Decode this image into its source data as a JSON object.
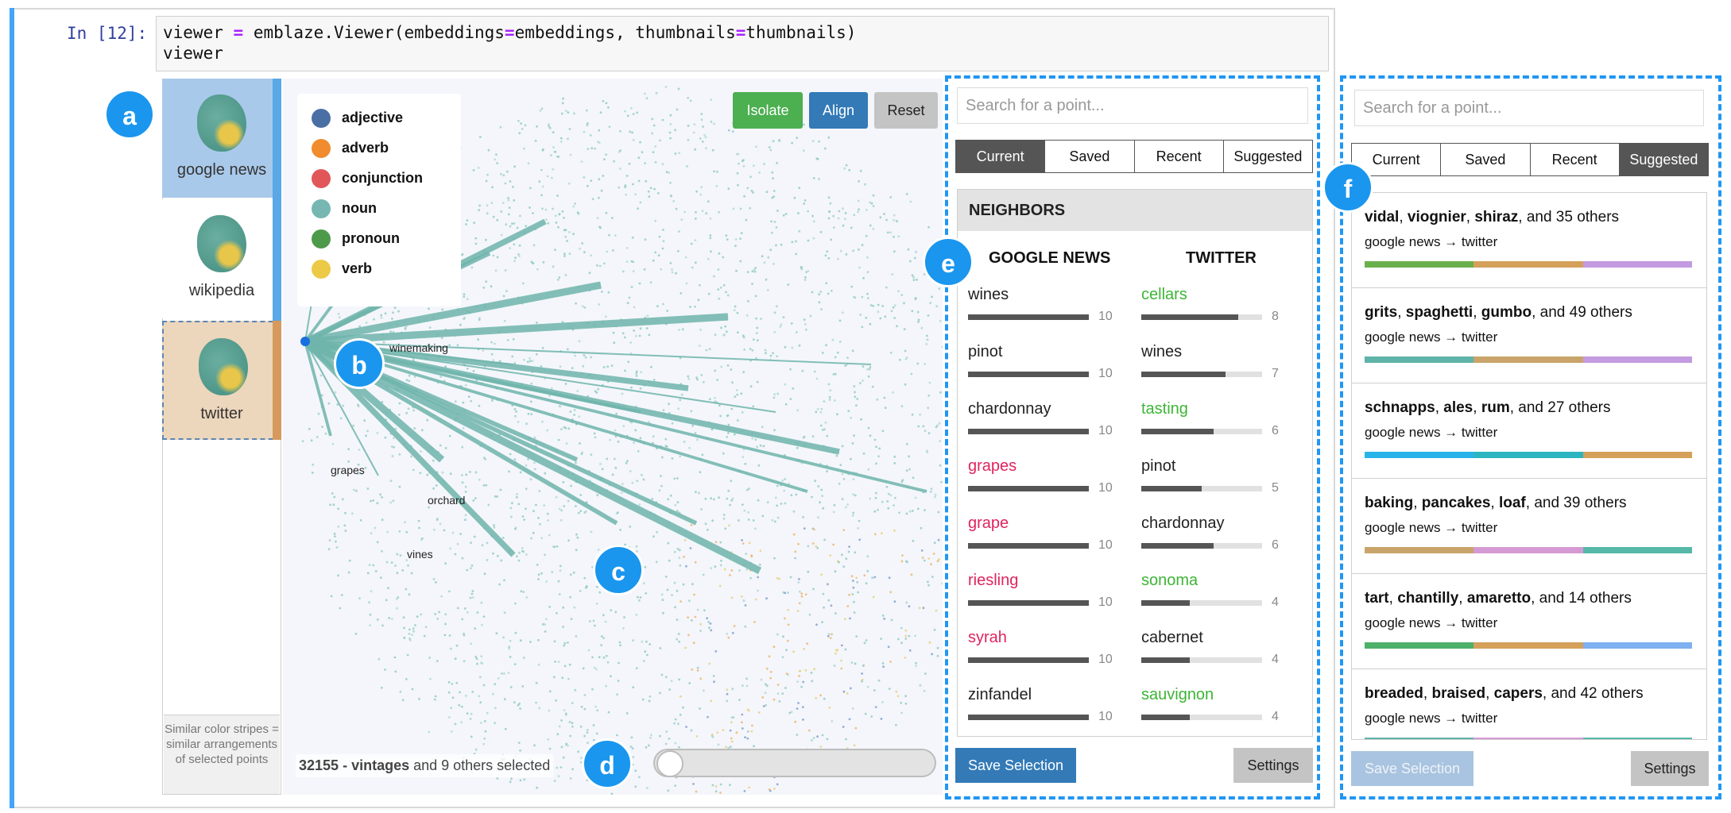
{
  "notebook": {
    "prompt": "In [12]:",
    "code_line1_parts": [
      "viewer ",
      "=",
      " emblaze.Viewer(embeddings",
      "=",
      "embeddings, thumbnails",
      "=",
      "thumbnails)"
    ],
    "code_line2": "viewer"
  },
  "sidebar": {
    "thumbnails": [
      {
        "label": "google news",
        "stripe_color": "#5aa8e6"
      },
      {
        "label": "wikipedia",
        "stripe_color": "#5aa8e6"
      },
      {
        "label": "twitter",
        "stripe_color": "#d69a5e"
      }
    ],
    "hint": "Similar color stripes = similar arrangements of selected points"
  },
  "legend": [
    {
      "label": "adjective",
      "color": "#4a6fa5"
    },
    {
      "label": "adverb",
      "color": "#f08c2e"
    },
    {
      "label": "conjunction",
      "color": "#e15759"
    },
    {
      "label": "noun",
      "color": "#76b7b2"
    },
    {
      "label": "pronoun",
      "color": "#4e9a4b"
    },
    {
      "label": "verb",
      "color": "#edc948"
    }
  ],
  "plot_buttons": {
    "isolate": "Isolate",
    "align": "Align",
    "reset": "Reset"
  },
  "point_labels": {
    "winemaking": "winemaking",
    "grapes": "grapes",
    "orchard": "orchard",
    "vines": "vines"
  },
  "annotations": {
    "a": "a",
    "b": "b",
    "c": "c",
    "d": "d",
    "e": "e",
    "f": "f"
  },
  "status": {
    "count": "32155",
    "separator": " - ",
    "word": "vintages",
    "rest": " and 9 others selected"
  },
  "slider": {
    "value": 0
  },
  "panel_e": {
    "search_placeholder": "Search for a point...",
    "tabs": [
      "Current",
      "Saved",
      "Recent",
      "Suggested"
    ],
    "active_tab": "Current",
    "header": "NEIGHBORS",
    "col_left": "GOOGLE NEWS",
    "col_right": "TWITTER",
    "left": [
      {
        "word": "wines",
        "count": "10",
        "value": 1.0,
        "color": "#222222"
      },
      {
        "word": "pinot",
        "count": "10",
        "value": 1.0,
        "color": "#222222"
      },
      {
        "word": "chardonnay",
        "count": "10",
        "value": 1.0,
        "color": "#222222"
      },
      {
        "word": "grapes",
        "count": "10",
        "value": 1.0,
        "color": "#e0245e"
      },
      {
        "word": "grape",
        "count": "10",
        "value": 1.0,
        "color": "#e0245e"
      },
      {
        "word": "riesling",
        "count": "10",
        "value": 1.0,
        "color": "#e0245e"
      },
      {
        "word": "syrah",
        "count": "10",
        "value": 1.0,
        "color": "#e0245e"
      },
      {
        "word": "zinfandel",
        "count": "10",
        "value": 1.0,
        "color": "#222222"
      }
    ],
    "right": [
      {
        "word": "cellars",
        "count": "8",
        "value": 0.8,
        "color": "#3db535"
      },
      {
        "word": "wines",
        "count": "7",
        "value": 0.7,
        "color": "#222222"
      },
      {
        "word": "tasting",
        "count": "6",
        "value": 0.6,
        "color": "#3db535"
      },
      {
        "word": "pinot",
        "count": "5",
        "value": 0.5,
        "color": "#222222"
      },
      {
        "word": "chardonnay",
        "count": "6",
        "value": 0.6,
        "color": "#222222"
      },
      {
        "word": "sonoma",
        "count": "4",
        "value": 0.4,
        "color": "#3db535"
      },
      {
        "word": "cabernet",
        "count": "4",
        "value": 0.4,
        "color": "#222222"
      },
      {
        "word": "sauvignon",
        "count": "4",
        "value": 0.4,
        "color": "#3db535"
      }
    ],
    "save_button": "Save Selection",
    "settings_button": "Settings"
  },
  "panel_f": {
    "search_placeholder": "Search for a point...",
    "tabs": [
      "Current",
      "Saved",
      "Recent",
      "Suggested"
    ],
    "active_tab": "Suggested",
    "items": [
      {
        "w1": "vidal",
        "w2": "viognier",
        "w3": "shiraz",
        "rest": ", and 35 others",
        "sub": "google news → twitter",
        "stripes": [
          "#6ab04c",
          "#d4a05a",
          "#c39be0"
        ]
      },
      {
        "w1": "grits",
        "w2": "spaghetti",
        "w3": "gumbo",
        "rest": ", and 49 others",
        "sub": "google news → twitter",
        "stripes": [
          "#5fb3a8",
          "#c9a46a",
          "#c39be0"
        ]
      },
      {
        "w1": "schnapps",
        "w2": "ales",
        "w3": "rum",
        "rest": ", and 27 others",
        "sub": "google news → twitter",
        "stripes": [
          "#27b4e8",
          "#2bb5c0",
          "#d4a05a"
        ]
      },
      {
        "w1": "baking",
        "w2": "pancakes",
        "w3": "loaf",
        "rest": ", and 39 others",
        "sub": "google news → twitter",
        "stripes": [
          "#c9a46a",
          "#d59ad4",
          "#56b8a8"
        ]
      },
      {
        "w1": "tart",
        "w2": "chantilly",
        "w3": "amaretto",
        "rest": ", and 14 others",
        "sub": "google news → twitter",
        "stripes": [
          "#4fb06a",
          "#d4a05a",
          "#7fb0f0"
        ]
      },
      {
        "w1": "breaded",
        "w2": "braised",
        "w3": "capers",
        "rest": ", and 42 others",
        "sub": "google news → twitter",
        "stripes": [
          "#5fb3a8",
          "#d59ad4",
          "#56b8a8"
        ]
      }
    ],
    "save_button": "Save Selection",
    "settings_button": "Settings"
  }
}
